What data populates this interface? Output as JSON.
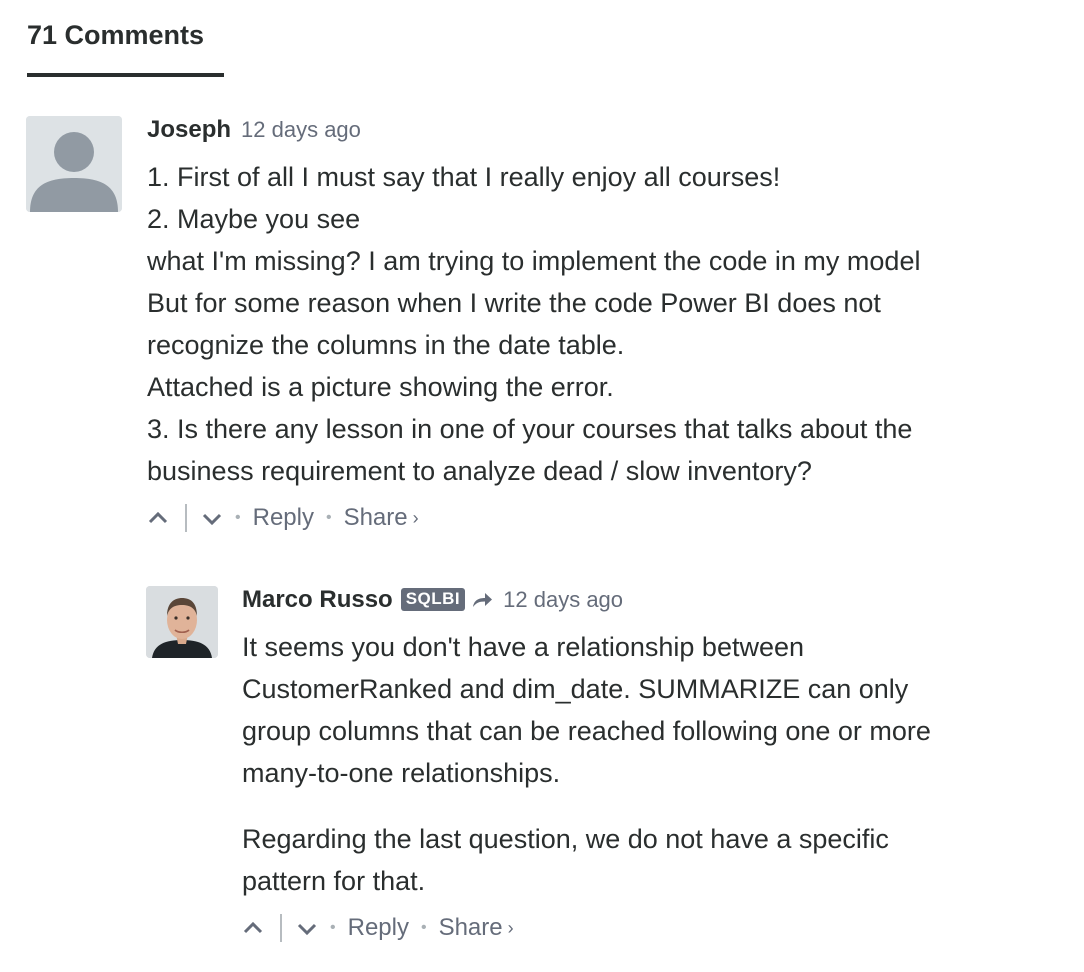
{
  "section": {
    "tab_label": "71 Comments"
  },
  "comments": [
    {
      "author": "Joseph",
      "time": "12 days ago",
      "avatar": "default-avatar-icon",
      "lines": [
        "1. First of all I must say that I really enjoy all courses!",
        "2. Maybe you see",
        "what I'm missing? I am trying to implement the code in my model",
        "But for some reason when I write the code Power BI does not",
        "recognize the columns in the date table.",
        "Attached is a picture showing the error.",
        "3. Is there any lesson in one of your courses that talks about the",
        "business requirement to analyze dead / slow inventory?"
      ],
      "actions": {
        "reply": "Reply",
        "share": "Share",
        "share_chevron": "›"
      }
    },
    {
      "author": "Marco Russo",
      "badge": "SQLBI",
      "time": "12 days ago",
      "avatar": "user-photo-avatar",
      "paragraphs": [
        [
          "It seems you don't have a relationship between",
          "CustomerRanked and dim_date. SUMMARIZE can only",
          "group columns that can be reached following one or more",
          "many-to-one relationships."
        ],
        [
          "Regarding the last question, we do not have a specific",
          "pattern for that."
        ]
      ],
      "actions": {
        "reply": "Reply",
        "share": "Share",
        "share_chevron": "›"
      }
    }
  ],
  "colors": {
    "text": "#2a2e2e",
    "muted": "#656c7a",
    "badge_bg": "#656c7a"
  }
}
